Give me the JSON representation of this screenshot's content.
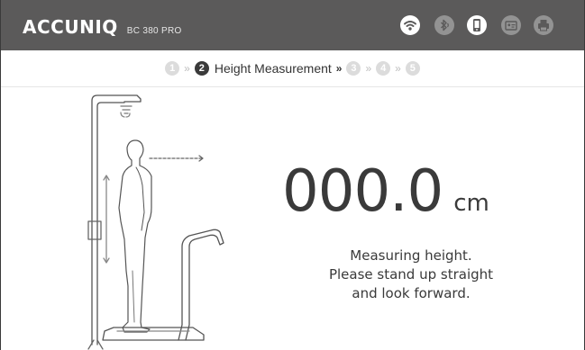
{
  "header": {
    "brand": "ACCUNIQ",
    "model": "BC 380 PRO",
    "icons": [
      {
        "name": "wifi-icon",
        "active": true
      },
      {
        "name": "bluetooth-icon",
        "active": false
      },
      {
        "name": "phone-icon",
        "active": true
      },
      {
        "name": "id-card-icon",
        "active": false
      },
      {
        "name": "printer-icon",
        "active": false
      }
    ]
  },
  "steps": {
    "items": [
      "1",
      "2",
      "3",
      "4",
      "5"
    ],
    "active_index": 1,
    "active_label": "Height Measurement",
    "separator": "»"
  },
  "measurement": {
    "value": "000.0",
    "unit": "cm"
  },
  "instruction": {
    "lines": [
      "Measuring height.",
      "Please stand up straight",
      "and look forward."
    ]
  },
  "colors": {
    "header_bg": "#5b5a5a",
    "icon_inactive": "#939393",
    "step_inactive": "#dcdcdc",
    "step_active": "#3a3a3a",
    "text": "#3a3a3a"
  }
}
